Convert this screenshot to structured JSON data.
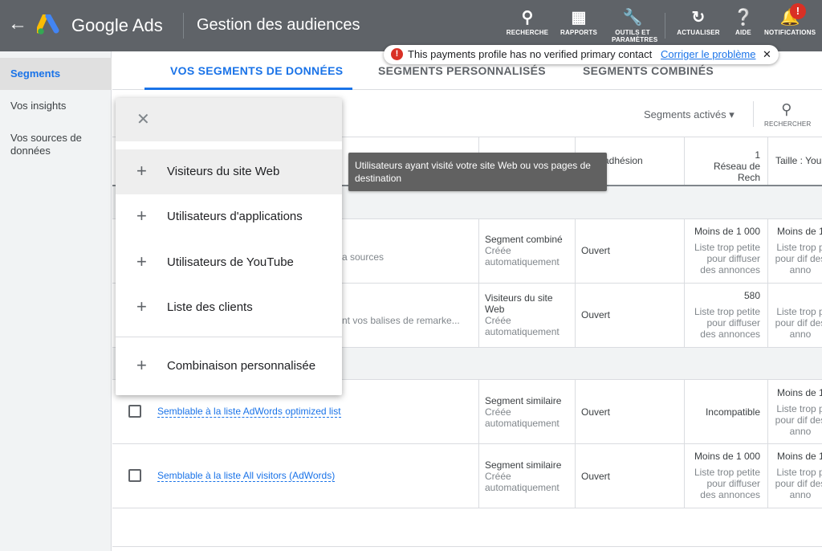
{
  "header": {
    "app_name": "Google Ads",
    "page_title": "Gestion des audiences",
    "actions": [
      {
        "label": "RECHERCHE",
        "icon": "search-icon"
      },
      {
        "label": "RAPPORTS",
        "icon": "bar-chart-icon"
      },
      {
        "label": "OUTILS ET PARAMÈTRES",
        "icon": "wrench-icon"
      },
      {
        "label": "ACTUALISER",
        "icon": "refresh-icon"
      },
      {
        "label": "AIDE",
        "icon": "help-icon"
      },
      {
        "label": "NOTIFICATIONS",
        "icon": "bell-icon",
        "badge": "!"
      }
    ]
  },
  "alert": {
    "message": "This payments profile has no verified primary contact",
    "link": "Corriger le problème"
  },
  "sidebar": {
    "items": [
      {
        "label": "Segments",
        "active": true
      },
      {
        "label": "Vos insights"
      },
      {
        "label": "Vos sources de données"
      }
    ]
  },
  "tabs": [
    {
      "label": "VOS SEGMENTS DE DONNÉES",
      "active": true
    },
    {
      "label": "SEGMENTS PERSONNALISÉS"
    },
    {
      "label": "SEGMENTS COMBINÉS"
    }
  ],
  "toolbar": {
    "filter": "Segments activés",
    "search": "RECHERCHER"
  },
  "table": {
    "headers": {
      "adhesion": "adhésion",
      "reseau_top": "1",
      "reseau": "Réseau de Rech",
      "taille": "Taille : You"
    },
    "rows": [
      {
        "name_partial": "a sources",
        "type": "Segment combiné",
        "type_sub": "Créée automatiquement",
        "adhesion": "Ouvert",
        "reseau": "Moins de 1 000",
        "reseau_sub": "Liste trop petite pour diffuser des annonces",
        "taille": "Moins de 1",
        "taille_sub": "Liste trop p pour dif des anno"
      },
      {
        "name_partial": "nt vos balises de remarke...",
        "type": "Visiteurs du site Web",
        "type_sub": "Créée automatiquement",
        "adhesion": "Ouvert",
        "reseau": "580",
        "reseau_sub": "Liste trop petite pour diffuser des annonces",
        "taille": "",
        "taille_sub": "Liste trop p pour dif des anno"
      },
      {
        "name": "Semblable à la liste AdWords optimized list",
        "type": "Segment similaire",
        "type_sub": "Créée automatiquement",
        "adhesion": "Ouvert",
        "reseau": "Incompatible",
        "reseau_sub": "",
        "taille": "Moins de 1",
        "taille_sub": "Liste trop p pour dif des anno"
      },
      {
        "name": "Semblable à la liste All visitors (AdWords)",
        "type": "Segment similaire",
        "type_sub": "Créée automatiquement",
        "adhesion": "Ouvert",
        "reseau": "Moins de 1 000",
        "reseau_sub": "Liste trop petite pour diffuser des annonces",
        "taille": "Moins de 1",
        "taille_sub": "Liste trop p pour dif des anno"
      }
    ]
  },
  "menu": {
    "items": [
      "Visiteurs du site Web",
      "Utilisateurs d'applications",
      "Utilisateurs de YouTube",
      "Liste des clients",
      "Combinaison personnalisée"
    ]
  },
  "tooltip": "Utilisateurs ayant visité votre site Web ou vos pages de destination",
  "colors": {
    "topbar": "#5f6368",
    "accent": "#1a73e8",
    "error": "#d93025"
  }
}
